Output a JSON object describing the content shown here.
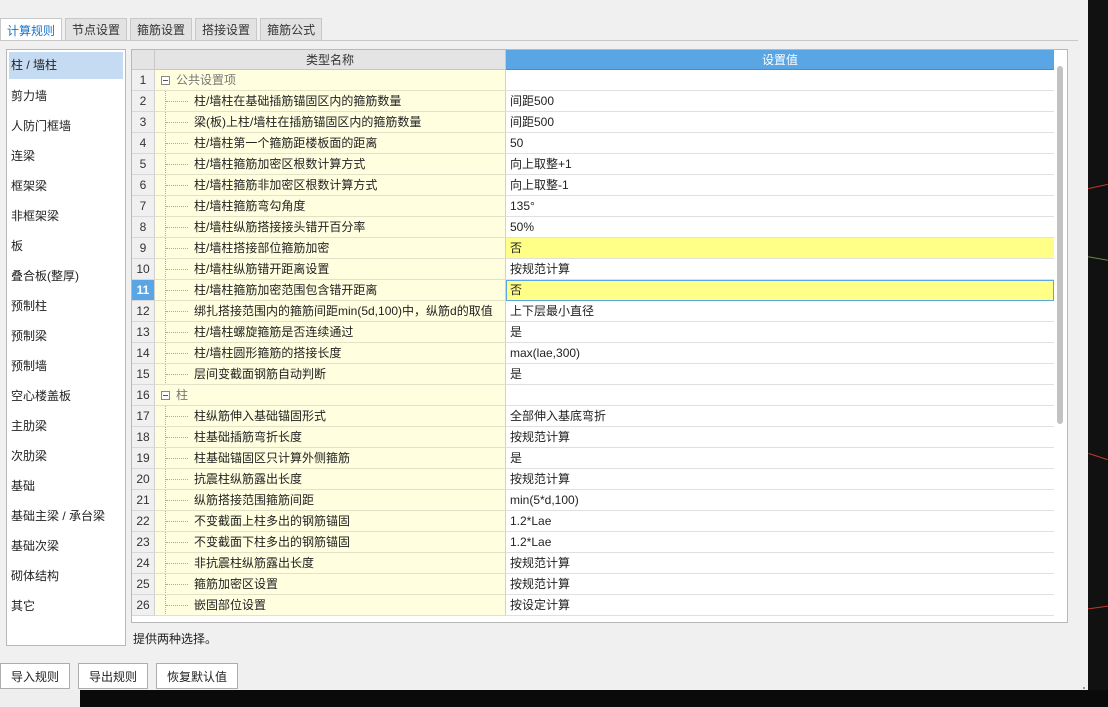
{
  "tabs": [
    {
      "label": "计算规则",
      "active": true
    },
    {
      "label": "节点设置",
      "active": false
    },
    {
      "label": "箍筋设置",
      "active": false
    },
    {
      "label": "搭接设置",
      "active": false
    },
    {
      "label": "箍筋公式",
      "active": false
    }
  ],
  "left_list": {
    "selected": "柱 / 墙柱",
    "items": [
      "柱 / 墙柱",
      "剪力墙",
      "人防门框墙",
      "连梁",
      "框架梁",
      "非框架梁",
      "板",
      "叠合板(整厚)",
      "预制柱",
      "预制梁",
      "预制墙",
      "空心楼盖板",
      "主肋梁",
      "次肋梁",
      "基础",
      "基础主梁 / 承台梁",
      "基础次梁",
      "砌体结构",
      "其它"
    ]
  },
  "grid": {
    "header_name": "类型名称",
    "header_value": "设置值",
    "selected_row": "11",
    "rows": [
      {
        "num": "1",
        "name": "公共设置项",
        "value": "",
        "group": true
      },
      {
        "num": "2",
        "name": "柱/墙柱在基础插筋锚固区内的箍筋数量",
        "value": "间距500"
      },
      {
        "num": "3",
        "name": "梁(板)上柱/墙柱在插筋锚固区内的箍筋数量",
        "value": "间距500"
      },
      {
        "num": "4",
        "name": "柱/墙柱第一个箍筋距楼板面的距离",
        "value": "50"
      },
      {
        "num": "5",
        "name": "柱/墙柱箍筋加密区根数计算方式",
        "value": "向上取整+1"
      },
      {
        "num": "6",
        "name": "柱/墙柱箍筋非加密区根数计算方式",
        "value": "向上取整-1"
      },
      {
        "num": "7",
        "name": "柱/墙柱箍筋弯勾角度",
        "value": "135°"
      },
      {
        "num": "8",
        "name": "柱/墙柱纵筋搭接接头错开百分率",
        "value": "50%"
      },
      {
        "num": "9",
        "name": "柱/墙柱搭接部位箍筋加密",
        "value": "否",
        "highlight": true
      },
      {
        "num": "10",
        "name": "柱/墙柱纵筋错开距离设置",
        "value": "按规范计算"
      },
      {
        "num": "11",
        "name": "柱/墙柱箍筋加密范围包含错开距离",
        "value": "否",
        "focus": true
      },
      {
        "num": "12",
        "name": "绑扎搭接范围内的箍筋间距min(5d,100)中，纵筋d的取值",
        "value": "上下层最小直径"
      },
      {
        "num": "13",
        "name": "柱/墙柱螺旋箍筋是否连续通过",
        "value": "是"
      },
      {
        "num": "14",
        "name": "柱/墙柱圆形箍筋的搭接长度",
        "value": "max(lae,300)"
      },
      {
        "num": "15",
        "name": "层间变截面钢筋自动判断",
        "value": "是"
      },
      {
        "num": "16",
        "name": "柱",
        "value": "",
        "group": true
      },
      {
        "num": "17",
        "name": "柱纵筋伸入基础锚固形式",
        "value": "全部伸入基底弯折"
      },
      {
        "num": "18",
        "name": "柱基础插筋弯折长度",
        "value": "按规范计算"
      },
      {
        "num": "19",
        "name": "柱基础锚固区只计算外侧箍筋",
        "value": "是"
      },
      {
        "num": "20",
        "name": "抗震柱纵筋露出长度",
        "value": "按规范计算"
      },
      {
        "num": "21",
        "name": "纵筋搭接范围箍筋间距",
        "value": "min(5*d,100)"
      },
      {
        "num": "22",
        "name": "不变截面上柱多出的钢筋锚固",
        "value": "1.2*Lae"
      },
      {
        "num": "23",
        "name": "不变截面下柱多出的钢筋锚固",
        "value": "1.2*Lae"
      },
      {
        "num": "24",
        "name": "非抗震柱纵筋露出长度",
        "value": "按规范计算"
      },
      {
        "num": "25",
        "name": "箍筋加密区设置",
        "value": "按规范计算"
      },
      {
        "num": "26",
        "name": "嵌固部位设置",
        "value": "按设定计算"
      }
    ]
  },
  "hint": "提供两种选择。",
  "buttons": {
    "import": "导入规则",
    "export": "导出规则",
    "restore": "恢复默认值"
  },
  "colors": {
    "accent": "#5aa6e4",
    "name_column_bg": "#ffffe0",
    "highlight_value_bg": "#ffff88",
    "selected_list_bg": "#c5dbf2"
  }
}
